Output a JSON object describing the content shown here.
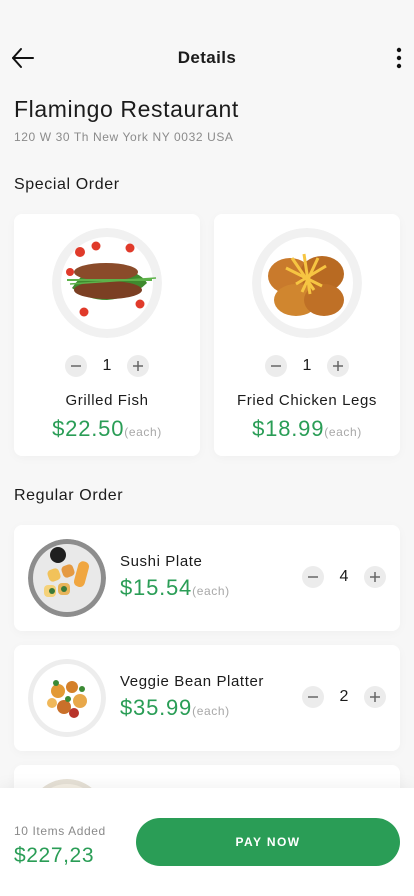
{
  "header": {
    "title": "Details",
    "back_icon": "arrow-left-icon",
    "menu_icon": "more-vertical-icon"
  },
  "restaurant": {
    "name": "Flamingo Restaurant",
    "address": "120 W 30 Th New York NY 0032 USA"
  },
  "special": {
    "title": "Special Order",
    "items": [
      {
        "name": "Grilled Fish",
        "qty": "1",
        "price": "$22.50",
        "each": "(each)"
      },
      {
        "name": "Fried Chicken Legs",
        "qty": "1",
        "price": "$18.99",
        "each": "(each)"
      }
    ]
  },
  "regular": {
    "title": "Regular Order",
    "items": [
      {
        "name": "Sushi Plate",
        "qty": "4",
        "price": "$15.54",
        "each": "(each)"
      },
      {
        "name": "Veggie Bean Platter",
        "qty": "2",
        "price": "$35.99",
        "each": "(each)"
      }
    ]
  },
  "footer": {
    "items_added": "10 Items Added",
    "total": "$227,23",
    "pay_label": "PAY NOW"
  },
  "colors": {
    "accent": "#2a9d56",
    "background": "#f7f7f7",
    "card": "#ffffff"
  }
}
